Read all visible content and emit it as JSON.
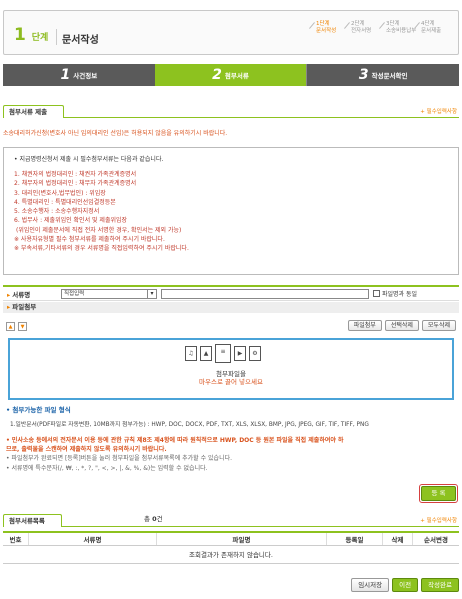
{
  "header": {
    "step_big_num": "1",
    "step_big_word": "단계",
    "title": "문서작성",
    "steps": [
      {
        "n": "1단계",
        "l": "문서작성",
        "on": true
      },
      {
        "n": "2단계",
        "l": "전자서명",
        "on": false
      },
      {
        "n": "3단계",
        "l": "소송비용납부",
        "on": false
      },
      {
        "n": "4단계",
        "l": "문서제출",
        "on": false
      }
    ]
  },
  "tabs": [
    {
      "num": "1",
      "label": "사건정보"
    },
    {
      "num": "2",
      "label": "첨부서류"
    },
    {
      "num": "3",
      "label": "작성문서확인"
    }
  ],
  "section1": {
    "label": "첨부서류 제출",
    "required": "+ 필수입력사항"
  },
  "notice": "소송대리허가신청(변호사 아닌 임의대리인 선임)은 허용되지 않음을 유의하기시 바랍니다.",
  "rules": {
    "intro": "• 지급명령신청서 제출 시 필수첨부서류는 다음과 같습니다.",
    "items": [
      "1. 채권자의 법정대리인 : 채권자 가족관계증명서",
      "2. 채무자의 법정대리인 : 채무자 가족관계증명서",
      "3. 대리인(변호사,법무법인) : 위임장",
      "4. 특별대리인 : 특별대리인선임결정등본",
      "5. 소송수행자 : 소송수행자지정서",
      "6. 법무사 : 제출위임인 확인서 및 제출위임장",
      "  (위임인이 제출문서에 직접 전자 서명한 경우, 확인서는 제외 가능)",
      "※ 사용자유형별 필수 첨부서류를 제출하여 주시기 바랍니다.",
      "※ 부속서류,기타서류의 경우 서류명을 직접입력하여 주시기 바랍니다."
    ]
  },
  "form": {
    "doc_label": "서류명",
    "doc_select": "직접입력",
    "same_as_file": "파일명과 동일",
    "file_label": "파일첨부"
  },
  "file_buttons": [
    "파일첨부",
    "선택삭제",
    "모두삭제"
  ],
  "dropzone": {
    "line1": "첨부파일을",
    "line2": "마우스로 끌어 넣으세요"
  },
  "filetypes": {
    "title": "• 첨부가능한 파일 형식",
    "value": "1.일반문서(PDF파일로 자동변환, 10MB까지 첨부가능) : HWP, DOC, DOCX, PDF, TXT, XLS, XLSX, BMP, JPG, JPEG, GIF, TIF, TIFF, PNG"
  },
  "warnings": {
    "red": [
      "• 민사소송 등에서의 전자문서 이용 등에 관한 규칙 제8조 제4항에 따라 원칙적으로 HWP, DOC 등 원본 파일을 직접 제출하여야 하",
      "  므로, 출력물을 스캔하여 제출하지 않도록 유의하시기 바랍니다."
    ],
    "gray": [
      "• 파일첨부가 완료되면 [등록]버튼을 눌러 첨부파일을 첨부서류목록에 추가할 수 있습니다.",
      "• 서류명에 특수문자(/, ₩, :, *, ?, \", <, >, |, &, %, &)는 입력할 수 없습니다."
    ]
  },
  "register_button": "등 록",
  "section2": {
    "label": "첨부서류목록",
    "required": "+ 필수입력사항"
  },
  "total": {
    "prefix": "총",
    "count": "0",
    "suffix": "건"
  },
  "table": {
    "headers": [
      "번호",
      "서류명",
      "파일명",
      "등록일",
      "삭제",
      "순서변경"
    ],
    "empty": "조회결과가 존재하지 않습니다."
  },
  "bottom_buttons": {
    "save": "임시저장",
    "prev": "이전",
    "done": "작성완료"
  }
}
